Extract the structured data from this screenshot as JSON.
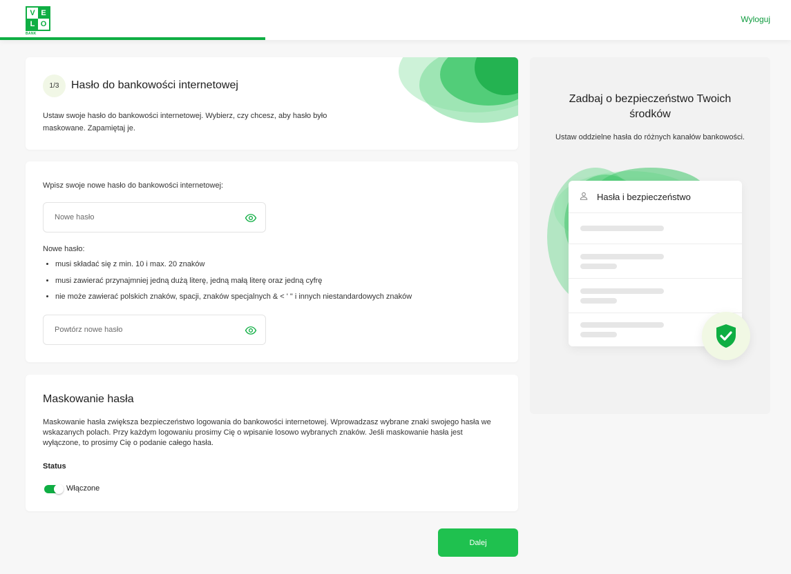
{
  "header": {
    "logo_letters": [
      "V",
      "E",
      "L",
      "O"
    ],
    "logo_sub": "BANK",
    "logout_label": "Wyloguj",
    "progress_fraction": 0.335
  },
  "step": {
    "counter": "1/3",
    "title": "Hasło do bankowości internetowej",
    "description": "Ustaw swoje hasło do bankowości internetowej. Wybierz, czy chcesz, aby hasło było maskowane. Zapamiętaj je."
  },
  "password_form": {
    "prompt": "Wpisz swoje nowe hasło do bankowości internetowej:",
    "new_password": {
      "value": "",
      "placeholder": "Nowe hasło"
    },
    "requirements_title": "Nowe hasło:",
    "requirements": [
      "musi składać się z min. 10 i max. 20 znaków",
      "musi zawierać przynajmniej jedną dużą literę, jedną małą literę oraz jedną cyfrę",
      "nie może zawierać polskich znaków, spacji, znaków specjalnych & < ' \" i innych niestandardowych znaków"
    ],
    "repeat_password": {
      "value": "",
      "placeholder": "Powtórz nowe hasło"
    }
  },
  "masking": {
    "title": "Maskowanie hasła",
    "description": "Maskowanie hasła zwiększa bezpieczeństwo logowania do bankowości internetowej. Wprowadzasz wybrane znaki swojego hasła we wskazanych polach. Przy każdym logowaniu prosimy Cię o wpisanie losowo wybranych znaków. Jeśli maskowanie hasła jest wyłączone, to prosimy Cię o podanie całego hasła.",
    "status_label": "Status",
    "toggle_on": true,
    "toggle_label": "Włączone"
  },
  "next_button_label": "Dalej",
  "side_panel": {
    "title": "Zadbaj o bezpieczeństwo Twoich środków",
    "description": "Ustaw oddzielne hasła do różnych kanałów bankowości.",
    "mock_title": "Hasła i bezpieczeństwo"
  },
  "colors": {
    "brand_green": "#0fae43",
    "button_green": "#1fc14f",
    "link_green": "#0f9b3e",
    "blob_green": "#3fc76a"
  },
  "icons": [
    "eye-icon",
    "user-icon",
    "shield-check-icon"
  ]
}
